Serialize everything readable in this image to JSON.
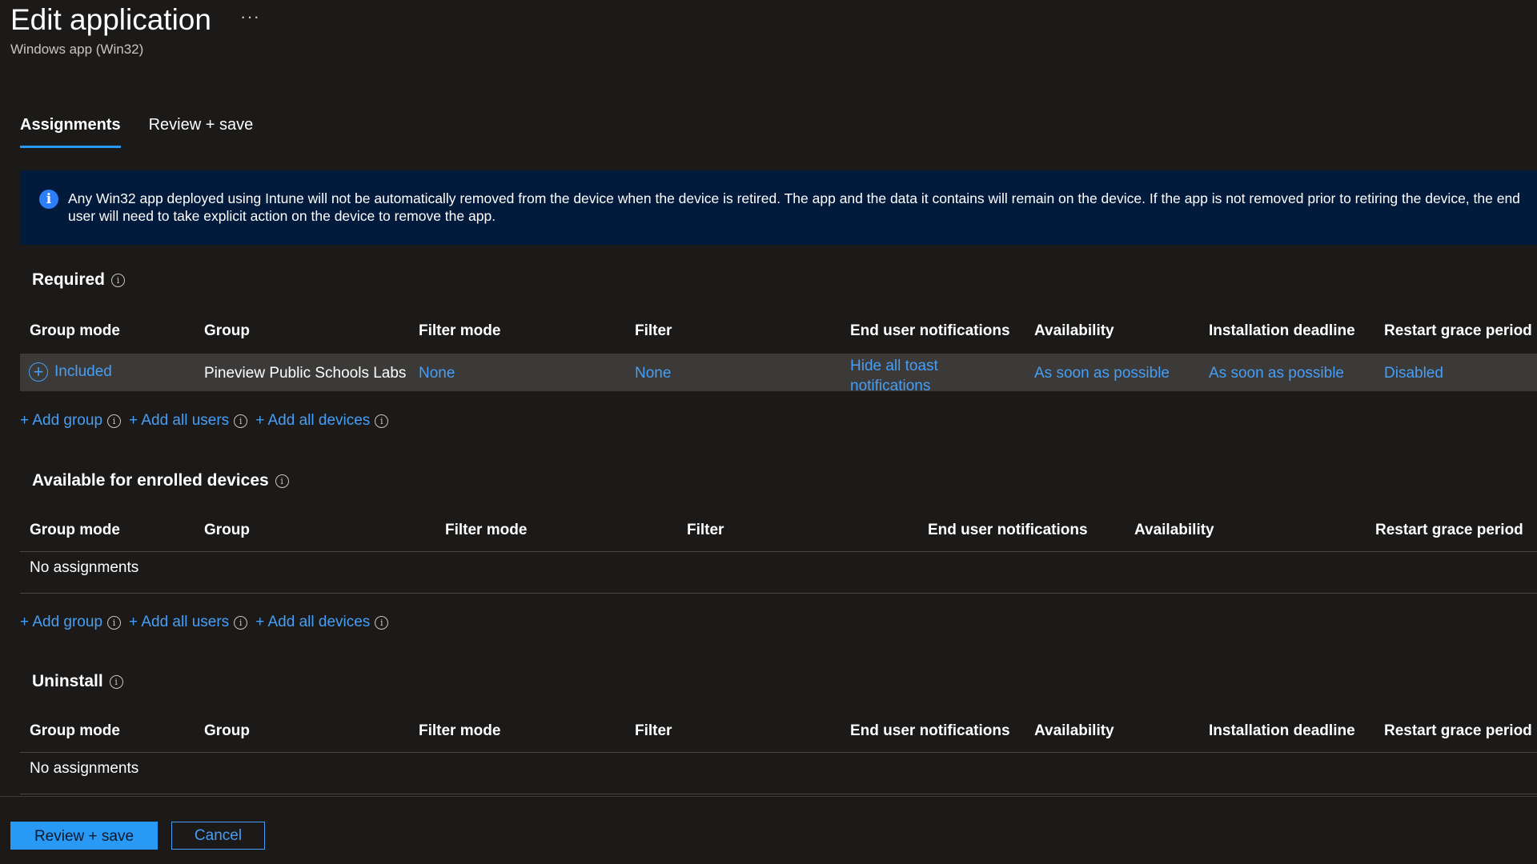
{
  "header": {
    "title": "Edit application",
    "more_label": "···",
    "subtitle": "Windows app (Win32)"
  },
  "tabs": [
    {
      "label": "Assignments",
      "active": true
    },
    {
      "label": "Review + save",
      "active": false
    }
  ],
  "banner": {
    "icon": "info-icon",
    "text": "Any Win32 app deployed using Intune will not be automatically removed from the device when the device is retired. The app and the data it contains will remain on the device. If the app is not removed prior to retiring the device, the end user will need to take explicit action on the device to remove the app."
  },
  "required": {
    "title": "Required",
    "columns": [
      "Group mode",
      "Group",
      "Filter mode",
      "Filter",
      "End user notifications",
      "Availability",
      "Installation deadline",
      "Restart grace period"
    ],
    "rows": [
      {
        "group_mode": "Included",
        "group": "Pineview Public Schools Labs",
        "filter_mode": "None",
        "filter": "None",
        "notifications": "Hide all toast notifications",
        "availability": "As soon as possible",
        "deadline": "As soon as possible",
        "restart_grace": "Disabled"
      }
    ]
  },
  "available": {
    "title": "Available for enrolled devices",
    "columns": [
      "Group mode",
      "Group",
      "Filter mode",
      "Filter",
      "End user notifications",
      "Availability",
      "Restart grace period"
    ],
    "empty_text": "No assignments"
  },
  "uninstall": {
    "title": "Uninstall",
    "columns": [
      "Group mode",
      "Group",
      "Filter mode",
      "Filter",
      "End user notifications",
      "Availability",
      "Installation deadline",
      "Restart grace period"
    ],
    "empty_text": "No assignments"
  },
  "add_links": {
    "add_group": "+ Add group",
    "add_all_users": "+ Add all users",
    "add_all_devices": "+ Add all devices"
  },
  "footer": {
    "primary_label": "Review + save",
    "secondary_label": "Cancel"
  },
  "colors": {
    "background": "#1b1a19",
    "accent": "#2899f5",
    "link": "#479ef5",
    "banner": "#021a3b",
    "selected_row": "#3b3a39"
  }
}
